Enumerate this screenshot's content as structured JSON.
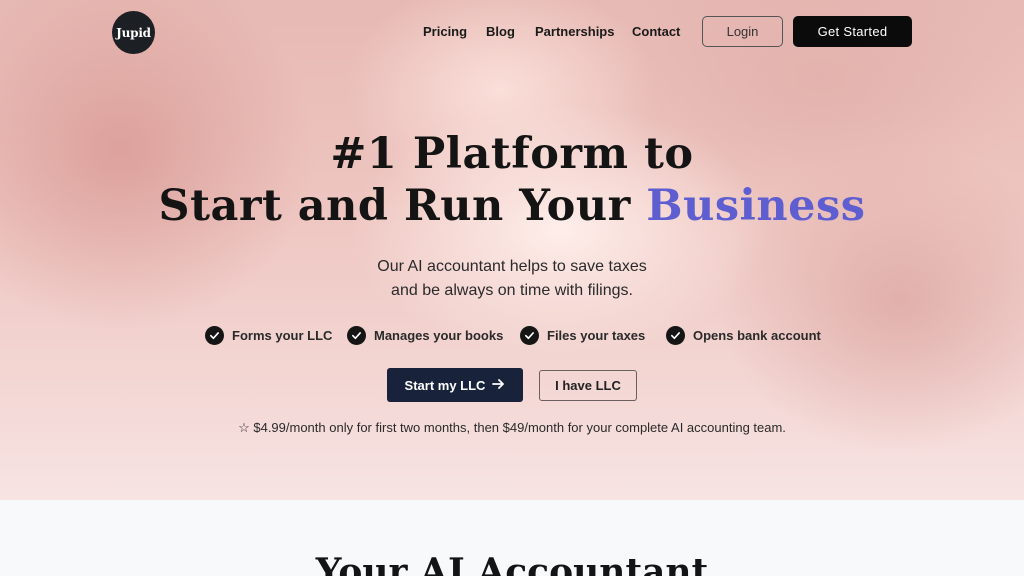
{
  "brand": {
    "logo_text": "Jupid"
  },
  "nav": {
    "items": [
      "Pricing",
      "Blog",
      "Partnerships",
      "Contact"
    ],
    "login_label": "Login",
    "get_started_label": "Get Started"
  },
  "hero": {
    "headline_line1": "#1 Platform to",
    "headline_line2_prefix": "Start and Run Your ",
    "headline_line2_accent": "Business",
    "subtitle_line1": "Our AI accountant helps to save taxes",
    "subtitle_line2": "and be always on time with filings.",
    "features": [
      "Forms your LLC",
      "Manages your books",
      "Files your taxes",
      "Opens bank account"
    ],
    "primary_cta_label": "Start my LLC",
    "secondary_cta_label": "I have LLC",
    "pricing_note": "$4.99/month only for first two months, then $49/month for your complete AI accounting team."
  },
  "next_section": {
    "title": "Your AI Accountant"
  },
  "icons": {
    "logo": "jupid-logo",
    "check": "check-icon",
    "arrow": "arrow-right-icon",
    "star": "star-outline-icon"
  },
  "colors": {
    "accent": "#5f5ed0",
    "primary_button": "#18233b",
    "header_button": "#0b0b0c",
    "hero_background": "#eec5c0"
  }
}
